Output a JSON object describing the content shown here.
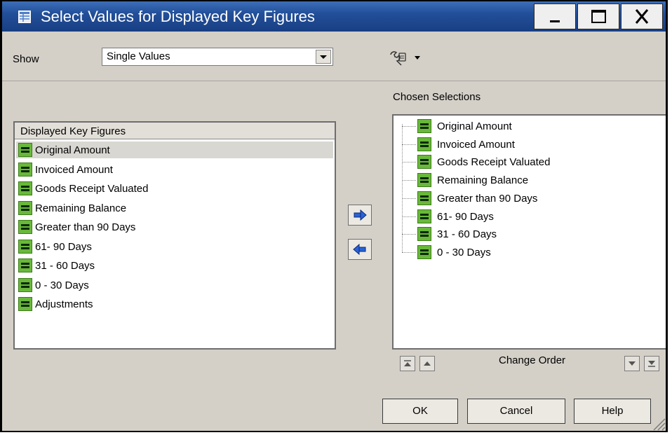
{
  "window": {
    "title": "Select Values for Displayed Key Figures",
    "icon": "table-grid-icon"
  },
  "toolbar": {
    "show_label": "Show",
    "show_value": "Single Values",
    "settings_icon": "wrench-icon"
  },
  "left_panel": {
    "header": "Displayed Key Figures",
    "items": [
      {
        "label": "Original Amount",
        "selected": true
      },
      {
        "label": "Invoiced Amount",
        "selected": false
      },
      {
        "label": "Goods Receipt Valuated",
        "selected": false
      },
      {
        "label": "Remaining Balance",
        "selected": false
      },
      {
        "label": "Greater than 90 Days",
        "selected": false
      },
      {
        "label": "61- 90 Days",
        "selected": false
      },
      {
        "label": "31 - 60 Days",
        "selected": false
      },
      {
        "label": "0 - 30 Days",
        "selected": false
      },
      {
        "label": "Adjustments",
        "selected": false
      }
    ]
  },
  "right_panel": {
    "header": "Chosen Selections",
    "items": [
      "Original Amount",
      "Invoiced Amount",
      "Goods Receipt Valuated",
      "Remaining Balance",
      "Greater than 90 Days",
      "61- 90 Days",
      "31 - 60 Days",
      "0 - 30 Days"
    ],
    "change_order_label": "Change Order"
  },
  "buttons": {
    "ok": "OK",
    "cancel": "Cancel",
    "help": "Help"
  },
  "colors": {
    "title_bar": "#224f99",
    "key_figure_icon": "#69b83b",
    "arrow": "#2a63d6"
  }
}
